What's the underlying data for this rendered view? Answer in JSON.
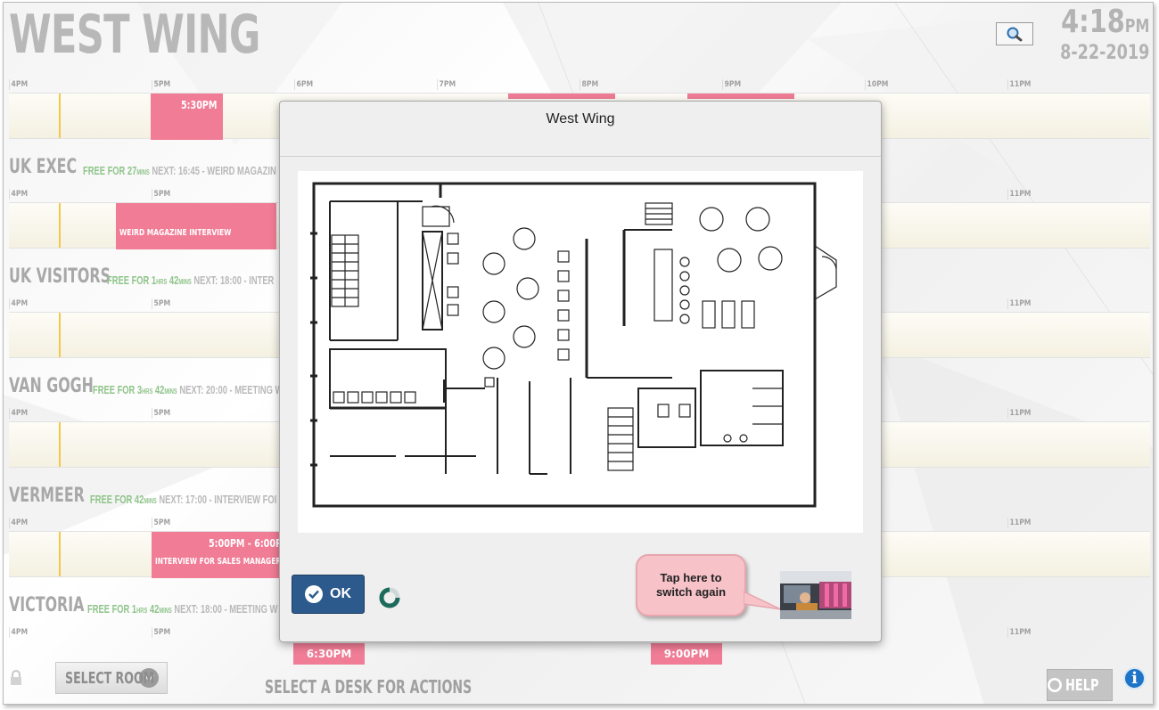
{
  "header": {
    "title": "WEST WING",
    "time": "4:18",
    "ampm": "PM",
    "date": "8-22-2019"
  },
  "timeline": {
    "hours": [
      "4PM",
      "5PM",
      "6PM",
      "7PM",
      "8PM",
      "9PM",
      "10PM",
      "11PM"
    ]
  },
  "top_lane": {
    "events": [
      {
        "time": "5:30PM"
      }
    ]
  },
  "rooms": [
    {
      "name": "UK EXEC",
      "free_a": "FREE FOR 27",
      "unit_a": "MINS",
      "free_b": "",
      "unit_b": "",
      "next": "NEXT: 16:45 - WEIRD MAGAZIN",
      "event_name": "WEIRD MAGAZINE INTERVIEW",
      "event_time": ""
    },
    {
      "name": "UK VISITORS",
      "free_a": "FREE FOR 1",
      "unit_a": "HRS",
      "free_b": "42",
      "unit_b": "MINS",
      "next": "NEXT: 18:00 - INTER",
      "event_name": "",
      "event_time": ""
    },
    {
      "name": "VAN GOGH",
      "free_a": "FREE FOR 3",
      "unit_a": "HRS",
      "free_b": "42",
      "unit_b": "MINS",
      "next": "NEXT: 20:00 - MEETING W",
      "event_name": "",
      "event_time": ""
    },
    {
      "name": "VERMEER",
      "free_a": "FREE FOR 42",
      "unit_a": "MINS",
      "free_b": "",
      "unit_b": "",
      "next": "NEXT: 17:00 - INTERVIEW FOI",
      "event_name": "INTERVIEW FOR SALES MANAGER",
      "event_time": "5:00PM - 6:00P"
    },
    {
      "name": "VICTORIA",
      "free_a": "FREE FOR 1",
      "unit_a": "HRS",
      "free_b": "42",
      "unit_b": "MINS",
      "next": "NEXT: 18:00 - MEETING W",
      "event_name": "",
      "event_time": ""
    }
  ],
  "bottom_events": [
    "6:30PM",
    "9:00PM"
  ],
  "footer": {
    "select_room": "SELECT ROOM",
    "select_desk": "SELECT A DESK FOR ACTIONS",
    "help": "HELP"
  },
  "modal": {
    "title": "West Wing",
    "ok_label": "OK",
    "tooltip_line1": "Tap here to",
    "tooltip_line2": "switch again"
  },
  "colors": {
    "event_pink": "#f07c96",
    "free_green": "#8fc48a",
    "now_line": "#f2c84b",
    "ok_button": "#2c5a8c",
    "info_blue": "#1e74c6"
  }
}
